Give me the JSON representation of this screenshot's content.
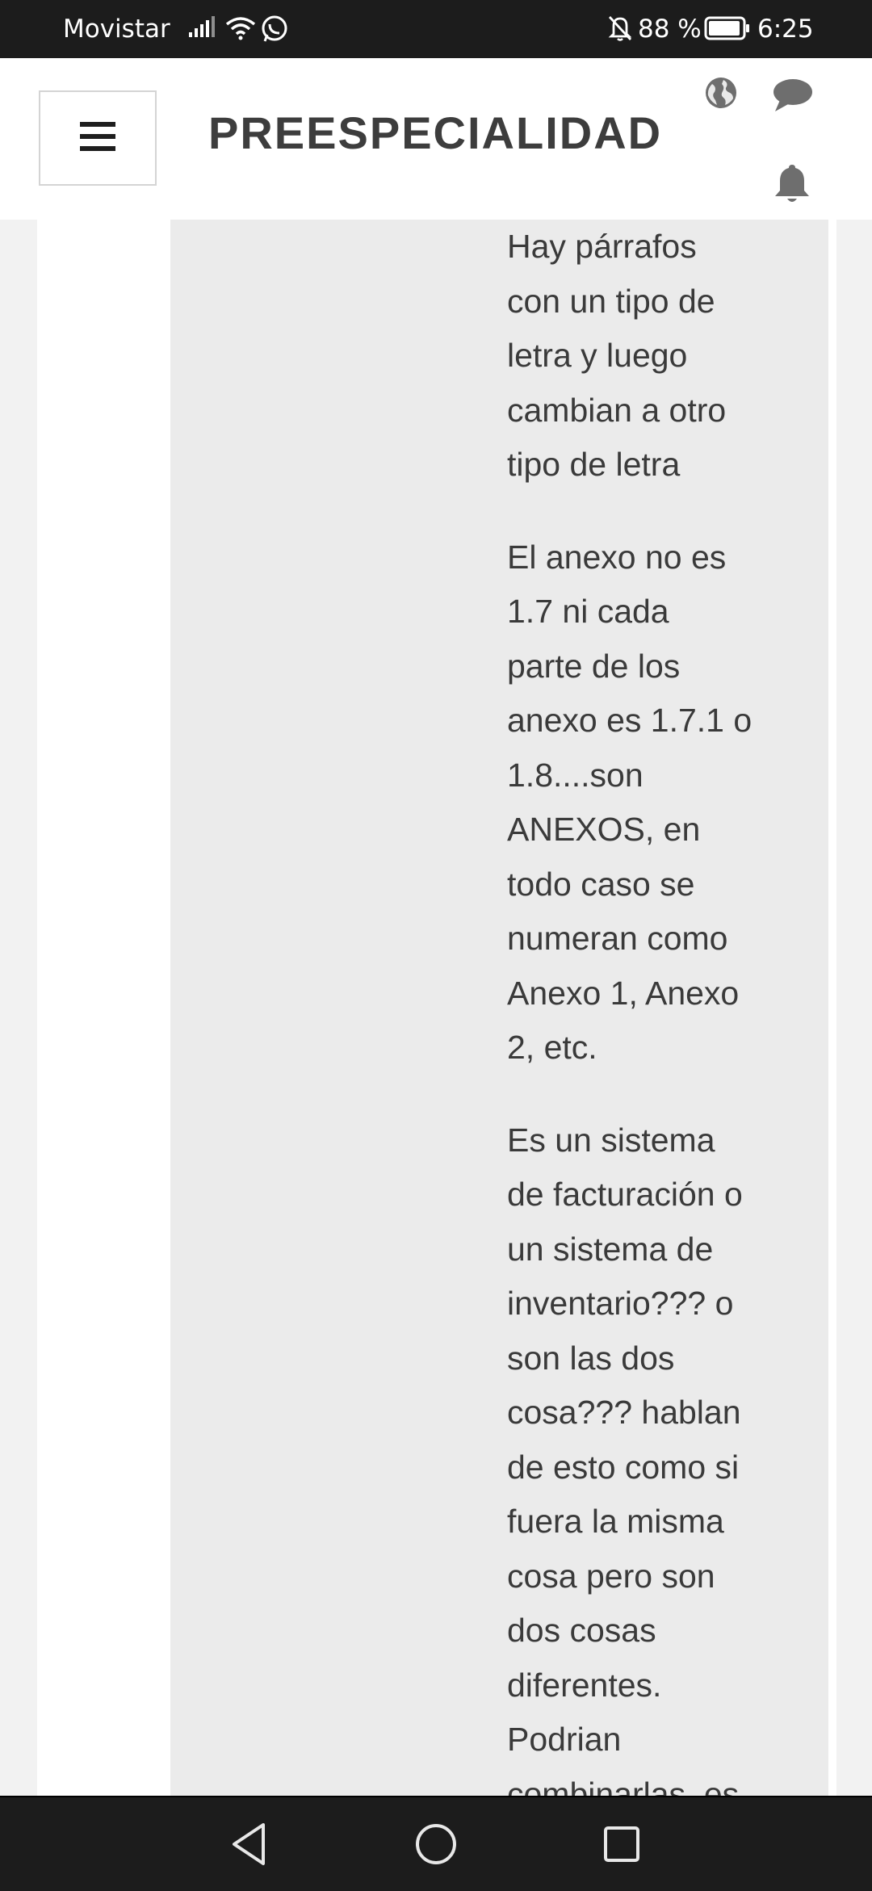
{
  "status_bar": {
    "carrier": "Movistar",
    "battery_percent": "88 %",
    "time": "6:25",
    "icons": [
      "signal-icon",
      "wifi-icon",
      "whatsapp-icon",
      "notifications-off-icon",
      "battery-icon"
    ]
  },
  "header": {
    "menu_icon": "hamburger-menu-icon",
    "title": "PREESPECIALIDAD",
    "actions": [
      "globe-icon",
      "chat-icon",
      "bell-icon"
    ]
  },
  "content": {
    "paragraphs": [
      "Hay párrafos\ncon un tipo de\nletra y luego\ncambian a otro\ntipo de letra",
      "El anexo no es\n1.7 ni cada\nparte de los\nanexo es 1.7.1 o\n1.8....son\nANEXOS, en\ntodo caso se\nnumeran como\nAnexo 1, Anexo\n2, etc.",
      "Es un sistema\nde facturación o\nun sistema de\ninventario??? o\nson las dos\ncosa???  hablan\nde esto como si\nfuera la misma\ncosa pero son\ndos cosas\ndiferentes.\nPodrian\ncombinarlas, es"
    ]
  },
  "nav_bar": {
    "buttons": [
      "back-icon",
      "home-icon",
      "recents-icon"
    ]
  },
  "colors": {
    "status_bar_bg": "#1c1c1c",
    "header_bg": "#ffffff",
    "title_text": "#3d3d3d",
    "panel_bg": "#ebebeb",
    "body_text": "#3a3a3a",
    "header_icon": "#6e6e6e"
  }
}
